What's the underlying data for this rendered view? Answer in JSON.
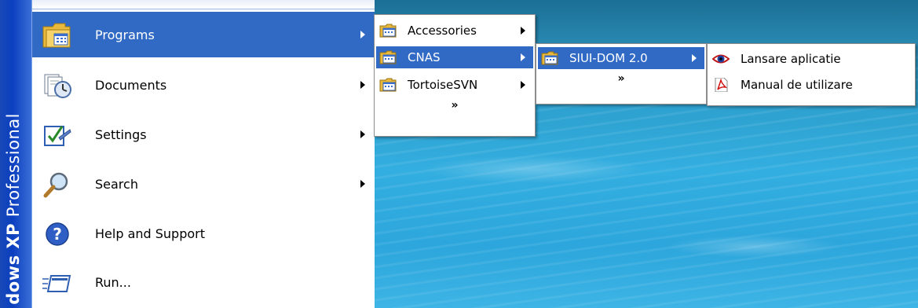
{
  "banner": {
    "text_bold": "dows XP",
    "text_light": "Professional"
  },
  "start_menu": {
    "items": [
      {
        "label": "Programs",
        "icon": "programs-folder-icon",
        "has_submenu": true,
        "highlighted": true
      },
      {
        "label": "Documents",
        "icon": "documents-icon",
        "has_submenu": true,
        "highlighted": false
      },
      {
        "label": "Settings",
        "icon": "settings-icon",
        "has_submenu": true,
        "highlighted": false
      },
      {
        "label": "Search",
        "icon": "search-icon",
        "has_submenu": true,
        "highlighted": false
      },
      {
        "label": "Help and Support",
        "icon": "help-icon",
        "has_submenu": false,
        "highlighted": false
      },
      {
        "label": "Run...",
        "icon": "run-icon",
        "has_submenu": false,
        "highlighted": false
      }
    ]
  },
  "programs_menu": {
    "items": [
      {
        "label": "Accessories",
        "icon": "program-group-icon",
        "highlighted": false
      },
      {
        "label": "CNAS",
        "icon": "program-group-icon",
        "highlighted": true
      },
      {
        "label": "TortoiseSVN",
        "icon": "program-group-icon",
        "highlighted": false
      }
    ],
    "more": "»"
  },
  "cnas_menu": {
    "items": [
      {
        "label": "SIUI-DOM 2.0",
        "icon": "program-group-icon",
        "highlighted": true
      }
    ],
    "more": "»"
  },
  "siui_menu": {
    "items": [
      {
        "label": "Lansare aplicatie",
        "icon": "eye-app-icon"
      },
      {
        "label": "Manual de utilizare",
        "icon": "pdf-icon"
      }
    ]
  },
  "colors": {
    "highlight": "#316ac5",
    "banner": "#0b3fbf"
  }
}
